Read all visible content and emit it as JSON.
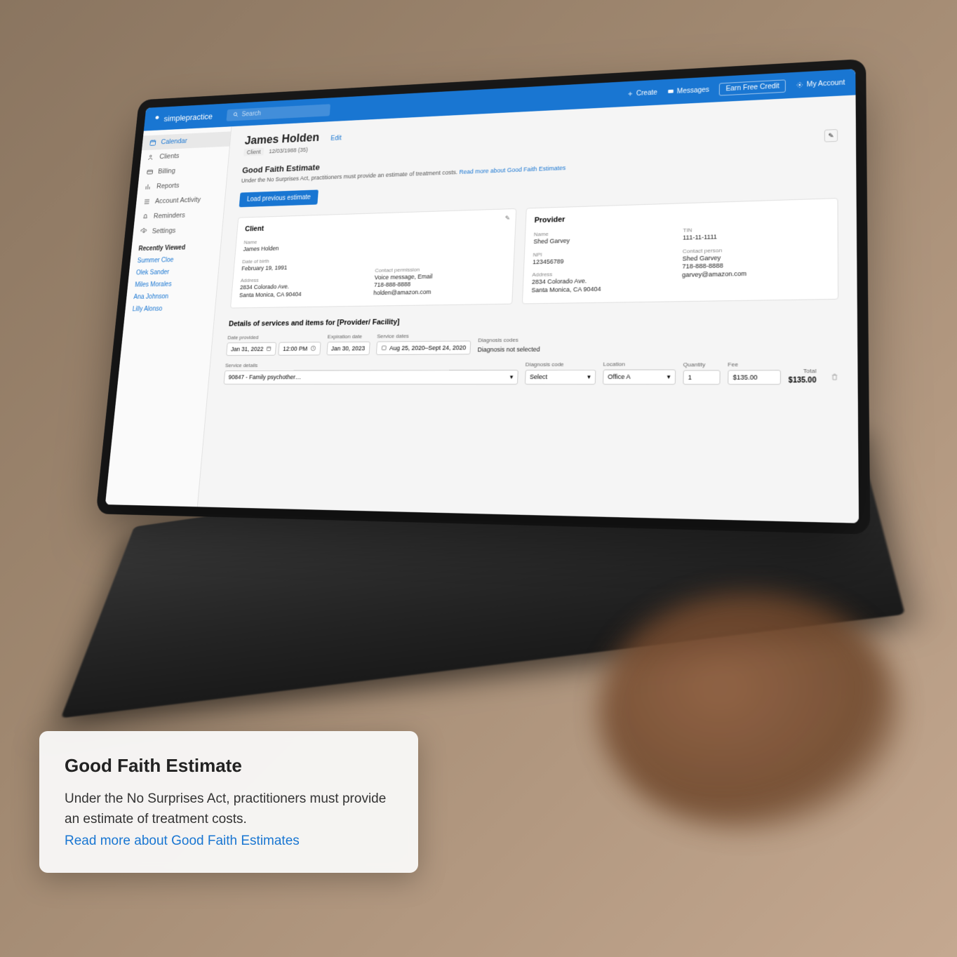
{
  "header": {
    "brand": "simplepractice",
    "search_placeholder": "Search",
    "create": "Create",
    "messages": "Messages",
    "earn": "Earn Free Credit",
    "account": "My Account"
  },
  "sidebar": {
    "items": [
      {
        "label": "Calendar"
      },
      {
        "label": "Clients"
      },
      {
        "label": "Billing"
      },
      {
        "label": "Reports"
      },
      {
        "label": "Account Activity"
      },
      {
        "label": "Reminders"
      },
      {
        "label": "Settings"
      }
    ],
    "recent_label": "Recently Viewed",
    "recent": [
      "Summer Cloe",
      "Olek Sander",
      "Miles Morales",
      "Ana Johnson",
      "Lilly Alonso"
    ]
  },
  "patient": {
    "name": "James Holden",
    "type": "Client",
    "dob_meta": "12/03/1988 (35)",
    "edit": "Edit"
  },
  "gfe": {
    "title": "Good Faith Estimate",
    "desc": "Under the No Surprises Act, practitioners must provide an estimate of treatment costs. ",
    "link": "Read more about Good Faith Estimates",
    "load_btn": "Load previous estimate"
  },
  "client_panel": {
    "title": "Client",
    "name_label": "Name",
    "name": "James Holden",
    "dob_label": "Date of birth",
    "dob": "February 19, 1991",
    "addr_label": "Address",
    "addr": "2834 Colorado Ave.\nSanta Monica, CA 90404",
    "contact_label": "Contact permission",
    "contact": "Voice message, Email\n718-888-8888\nholden@amazon.com"
  },
  "provider_panel": {
    "title": "Provider",
    "name_label": "Name",
    "name": "Shed Garvey",
    "npi_label": "NPI",
    "npi": "123456789",
    "addr_label": "Address",
    "addr": "2834 Colorado Ave.\nSanta Monica, CA 90404",
    "tin_label": "TIN",
    "tin": "111-11-1111",
    "contact_label": "Contact person",
    "contact": "Shed Garvey\n718-888-8888\ngarvey@amazon.com"
  },
  "details": {
    "title": "Details of services and items for [Provider/ Facility]",
    "date_provided_label": "Date provided",
    "date_provided": "Jan 31, 2022",
    "time_provided": "12:00 PM",
    "exp_label": "Expiration date",
    "exp": "Jan 30, 2023",
    "svc_dates_label": "Service dates",
    "svc_dates": "Aug 25, 2020–Sept 24, 2020",
    "diag_codes_label": "Diagnosis codes",
    "diag_codes": "Diagnosis not selected",
    "svc_details_label": "Service details",
    "svc_details": "90847 - Family psychother…",
    "diag_code_label": "Diagnosis code",
    "diag_code": "Select",
    "location_label": "Location",
    "location": "Office A",
    "qty_label": "Quantity",
    "qty": "1",
    "fee_label": "Fee",
    "fee": "$135.00",
    "total_label": "Total",
    "total": "$135.00"
  },
  "overlay": {
    "title": "Good Faith Estimate",
    "body": "Under the No Surprises Act, practitioners must provide an estimate of treatment costs.",
    "link": "Read more about Good Faith Estimates"
  }
}
